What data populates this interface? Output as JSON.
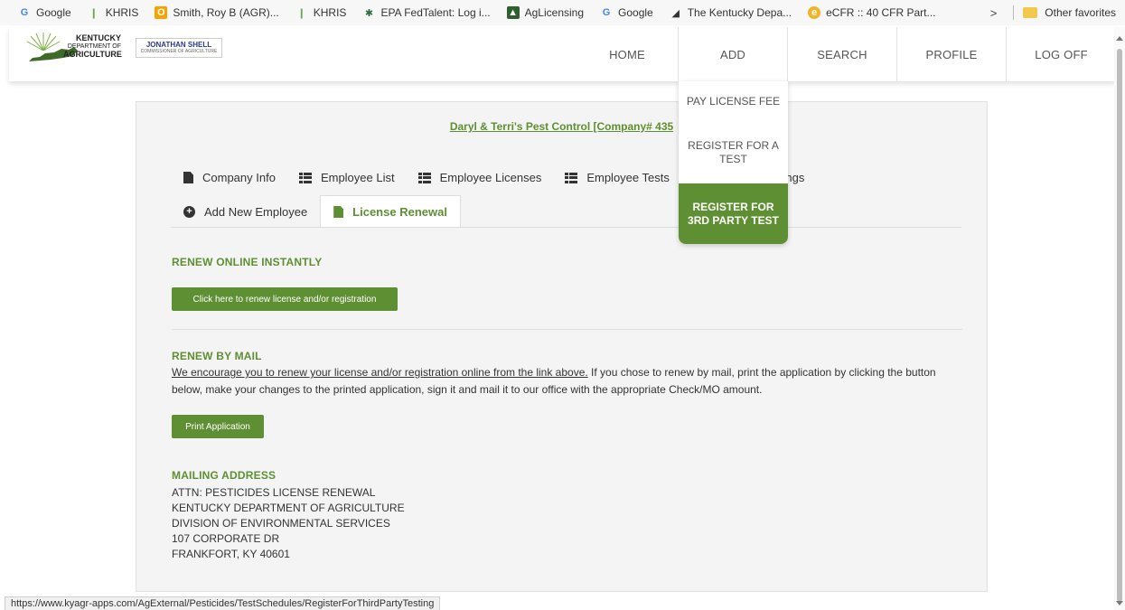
{
  "bookmarks": [
    {
      "label": "Google",
      "icon": "google-icon"
    },
    {
      "label": "KHRIS",
      "icon": "khris-icon"
    },
    {
      "label": "Smith, Roy B (AGR)...",
      "icon": "outlook-icon"
    },
    {
      "label": "KHRIS",
      "icon": "khris-icon"
    },
    {
      "label": "EPA FedTalent: Log i...",
      "icon": "epa-icon"
    },
    {
      "label": "AgLicensing",
      "icon": "aglicensing-icon"
    },
    {
      "label": "Google",
      "icon": "google-icon"
    },
    {
      "label": "The Kentucky Depa...",
      "icon": "ky-icon"
    },
    {
      "label": "eCFR :: 40 CFR Part...",
      "icon": "ecfr-icon"
    }
  ],
  "bookmarks_right": {
    "overflow": ">",
    "other": "Other favorites"
  },
  "logo": {
    "line1": "KENTUCKY",
    "line2": "DEPARTMENT OF",
    "line3": "AGRICULTURE"
  },
  "commissioner": {
    "name": "JONATHAN SHELL",
    "title": "COMMISSIONER OF AGRICULTURE"
  },
  "nav": {
    "home": "HOME",
    "add": "ADD",
    "search": "SEARCH",
    "profile": "PROFILE",
    "logoff": "LOG OFF"
  },
  "dropdown": {
    "pay_fee": "PAY LICENSE FEE",
    "register_test": "REGISTER FOR A TEST",
    "register_3rd": "REGISTER FOR 3RD PARTY TEST"
  },
  "company_title": "Daryl & Terri's Pest Control [Company# 435",
  "tabs": {
    "company_info": "Company Info",
    "employee_list": "Employee List",
    "employee_licenses": "Employee Licenses",
    "employee_tests": "Employee Tests",
    "trainings": "rainings",
    "add_employee": "Add New Employee",
    "license_renewal": "License Renewal"
  },
  "renew_online": {
    "title": "RENEW ONLINE INSTANTLY",
    "button": "Click here to renew license and/or registration"
  },
  "renew_mail": {
    "title": "RENEW BY MAIL",
    "link": "We encourage you to renew your license and/or registration online from the link above.",
    "text": " If you chose to renew by mail, print the application by clicking the button below, make your changes to the printed application, sign it and mail it to our office with the appropriate Check/MO amount.",
    "button": "Print Application"
  },
  "mailing": {
    "title": "MAILING ADDRESS",
    "lines": [
      "ATTN: PESTICIDES LICENSE RENEWAL",
      "KENTUCKY DEPARTMENT OF AGRICULTURE",
      "DIVISION OF ENVIRONMENTAL SERVICES",
      "107 CORPORATE DR",
      "FRANKFORT, KY 40601"
    ]
  },
  "status_url": "https://www.kyagr-apps.com/AgExternal/Pesticides/TestSchedules/RegisterForThirdPartyTesting",
  "colors": {
    "accent": "#5e8f32",
    "panel": "#f4f4f4"
  }
}
